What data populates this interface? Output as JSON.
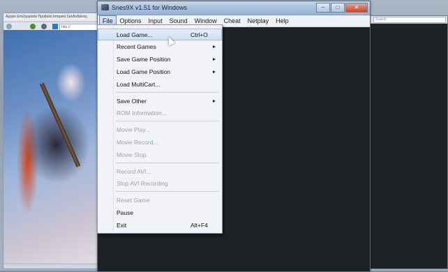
{
  "window": {
    "title": "Snes9X v1.51 for Windows",
    "buttons": {
      "minimize": "–",
      "maximize": "□",
      "close": "✕"
    }
  },
  "menubar": {
    "items": [
      "File",
      "Options",
      "Input",
      "Sound",
      "Window",
      "Cheat",
      "Netplay",
      "Help"
    ],
    "active": "File"
  },
  "file_menu": {
    "items": [
      {
        "label": "Load Game...",
        "shortcut": "Ctrl+O",
        "submenu": false,
        "enabled": true,
        "highlighted": true
      },
      {
        "label": "Recent Games",
        "shortcut": "",
        "submenu": true,
        "enabled": true
      },
      {
        "label": "Save Game Position",
        "shortcut": "",
        "submenu": true,
        "enabled": true
      },
      {
        "label": "Load Game Position",
        "shortcut": "",
        "submenu": true,
        "enabled": true
      },
      {
        "label": "Load MultiCart...",
        "shortcut": "",
        "submenu": false,
        "enabled": true
      },
      {
        "label": "Save Other",
        "shortcut": "",
        "submenu": true,
        "enabled": true
      },
      {
        "label": "ROM Information...",
        "shortcut": "",
        "submenu": false,
        "enabled": false
      },
      {
        "label": "Movie Play...",
        "shortcut": "",
        "submenu": false,
        "enabled": false
      },
      {
        "label": "Movie Record...",
        "shortcut": "",
        "submenu": false,
        "enabled": false
      },
      {
        "label": "Movie Stop",
        "shortcut": "",
        "submenu": false,
        "enabled": false
      },
      {
        "label": "Record AVI...",
        "shortcut": "",
        "submenu": false,
        "enabled": false
      },
      {
        "label": "Stop AVI Recording",
        "shortcut": "",
        "submenu": false,
        "enabled": false
      },
      {
        "label": "Reset Game",
        "shortcut": "",
        "submenu": false,
        "enabled": false
      },
      {
        "label": "Pause",
        "shortcut": "",
        "submenu": false,
        "enabled": true
      },
      {
        "label": "Exit",
        "shortcut": "Alt+F4",
        "submenu": false,
        "enabled": true
      }
    ]
  },
  "background_browser": {
    "menu_text": "Αρχείο Επεξεργασία Προβολή Ιστορικό Σελιδοδείκτες",
    "address_text": "http://",
    "search_placeholder": "Search"
  },
  "colors": {
    "emulator_screen": "#1d2124",
    "menu_background": "#f2f3f6",
    "highlight": "#cfe0f2",
    "disabled_text": "#9aa0a8"
  },
  "icons": [
    "snes9x-app-icon",
    "submenu-arrow-icon",
    "mouse-cursor-icon"
  ]
}
